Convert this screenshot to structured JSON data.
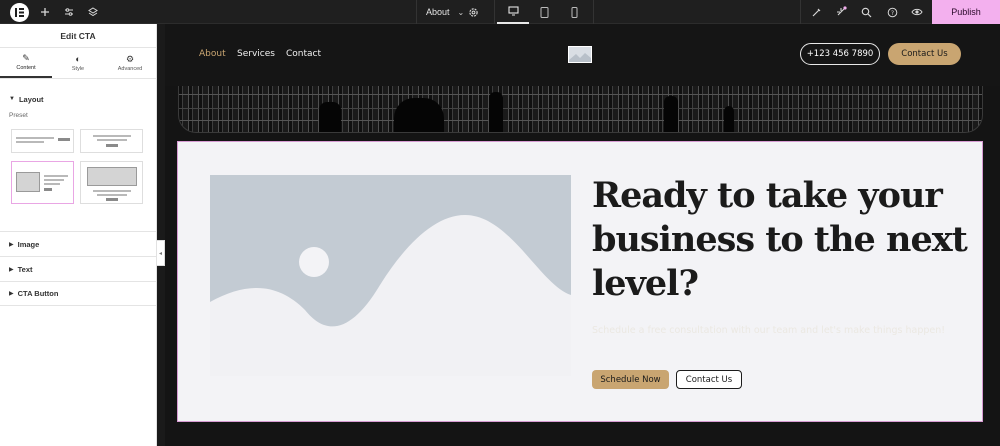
{
  "topbar": {
    "page_name": "About",
    "publish_label": "Publish",
    "icons": [
      "elementor-logo-icon",
      "plus-icon",
      "sliders-icon",
      "layers-icon",
      "settings-icon",
      "desktop-icon",
      "tablet-icon",
      "mobile-icon",
      "ai-icon",
      "notifications-icon",
      "search-icon",
      "help-icon",
      "preview-eye-icon"
    ]
  },
  "panel": {
    "title": "Edit CTA",
    "tabs": [
      {
        "label": "Content",
        "icon": "pencil-icon",
        "active": true
      },
      {
        "label": "Style",
        "icon": "half-circle-icon",
        "active": false
      },
      {
        "label": "Advanced",
        "icon": "gear-icon",
        "active": false
      }
    ],
    "layout_section": "Layout",
    "preset_label": "Preset",
    "sections": [
      "Image",
      "Text",
      "CTA Button"
    ]
  },
  "site": {
    "nav_links": [
      {
        "label": "About",
        "active": true
      },
      {
        "label": "Services",
        "active": false
      },
      {
        "label": "Contact",
        "active": false
      }
    ],
    "phone": "+123 456 7890",
    "contact_button": "Contact Us"
  },
  "cta": {
    "title": "Ready to take your business to the next level?",
    "description": "Schedule a free consultation with our team and let's make things happen!",
    "primary_button": "Schedule Now",
    "secondary_button": "Contact Us"
  },
  "colors": {
    "accent_gold": "#c9a571",
    "publish_pink": "#f3b0ee",
    "selection_border": "#d79bd3"
  }
}
